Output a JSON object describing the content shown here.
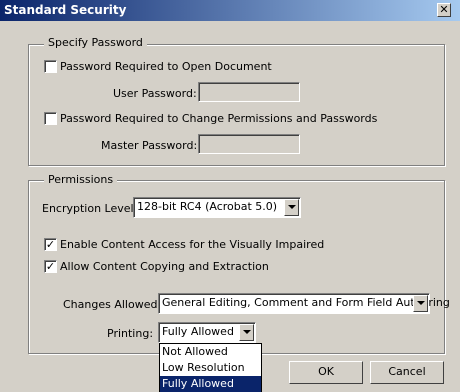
{
  "window": {
    "title": "Standard Security",
    "close_glyph": "✕"
  },
  "password_group": {
    "legend": "Specify Password",
    "open_doc_checkbox": {
      "label": "Password Required to Open Document",
      "checked": false
    },
    "user_password_label": "User Password:",
    "user_password_value": "",
    "perm_checkbox": {
      "label": "Password Required to Change Permissions and Passwords",
      "checked": false
    },
    "master_password_label": "Master Password:",
    "master_password_value": ""
  },
  "permissions_group": {
    "legend": "Permissions",
    "encryption_label": "Encryption Level:",
    "encryption_value": "128-bit RC4 (Acrobat 5.0)",
    "access_checkbox": {
      "label": "Enable Content Access for the Visually Impaired",
      "checked": true
    },
    "copy_checkbox": {
      "label": "Allow Content Copying and Extraction",
      "checked": true
    },
    "changes_label": "Changes Allowed:",
    "changes_value": "General Editing, Comment and Form Field Authoring",
    "printing_label": "Printing:",
    "printing_value": "Fully Allowed",
    "printing_options": [
      "Not Allowed",
      "Low Resolution",
      "Fully Allowed"
    ],
    "printing_selected_index": 2
  },
  "buttons": {
    "ok": "OK",
    "cancel": "Cancel"
  }
}
